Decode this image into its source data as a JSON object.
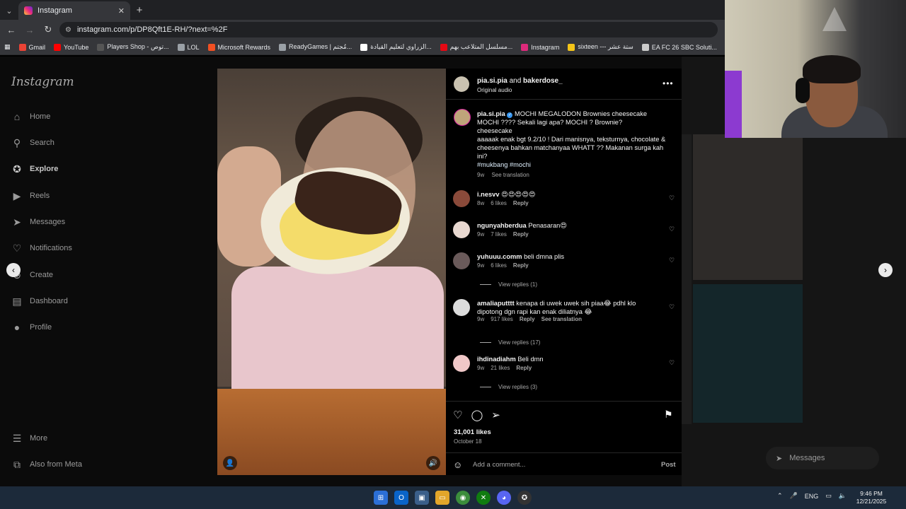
{
  "browser": {
    "tab_title": "Instagram",
    "new_tab": "+",
    "url": "instagram.com/p/DP8Qft1E-RH/?next=%2F",
    "bookmarks": [
      {
        "label": "Gmail",
        "color": "#ea4335"
      },
      {
        "label": "YouTube",
        "color": "#ff0000"
      },
      {
        "label": "Players Shop - توص...",
        "color": "#555555"
      },
      {
        "label": "LOL",
        "color": "#9aa0a6"
      },
      {
        "label": "Microsoft Rewards",
        "color": "#f25022"
      },
      {
        "label": "ReadyGames | مُجتم...",
        "color": "#9aa0a6"
      },
      {
        "label": "الزراوي لتعليم القيادة...",
        "color": "#ffffff"
      },
      {
        "label": "مسلسل المتلاعب بهم...",
        "color": "#e50914"
      },
      {
        "label": "Instagram",
        "color": "#dd2a7b"
      },
      {
        "label": "sixteen --- ستة عشر",
        "color": "#f5c518"
      },
      {
        "label": "EA FC 26 SBC Soluti...",
        "color": "#cccccc"
      }
    ]
  },
  "sidebar": {
    "logo": "Instagram",
    "items": [
      {
        "label": "Home",
        "icon": "home-icon",
        "glyph": "⌂"
      },
      {
        "label": "Search",
        "icon": "search-icon",
        "glyph": "⚲"
      },
      {
        "label": "Explore",
        "icon": "compass-icon",
        "glyph": "✪"
      },
      {
        "label": "Reels",
        "icon": "reels-icon",
        "glyph": "▶"
      },
      {
        "label": "Messages",
        "icon": "send-icon",
        "glyph": "➤"
      },
      {
        "label": "Notifications",
        "icon": "heart-icon",
        "glyph": "♡"
      },
      {
        "label": "Create",
        "icon": "plus-icon",
        "glyph": "⊕"
      },
      {
        "label": "Dashboard",
        "icon": "chart-icon",
        "glyph": "▤"
      },
      {
        "label": "Profile",
        "icon": "avatar-icon",
        "glyph": "●"
      }
    ],
    "more": "More",
    "also_from_meta": "Also from Meta"
  },
  "post": {
    "author": "pia.si.pia",
    "and": "and",
    "coauthor": "bakerdose_",
    "audio": "Original audio",
    "caption_user": "pia.si.pia",
    "caption_text": "MOCHI MEGALODON Brownies cheesecake MOCHI ???? Sekali lagi apa? MOCHI ? Brownie?",
    "caption_line2": "cheesecake",
    "caption_line3": "aaaaak enak bgt 9.2/10 ! Dari manisnya, teksturnya, chocolate & cheesenya bahkan matchanyaa WHATT ?? Makanan surga kah ini?",
    "hashtags": "#mukbang #mochi",
    "age": "9w",
    "see_translation": "See translation",
    "likes": "31,001 likes",
    "date": "October 18",
    "add_comment_placeholder": "Add a comment...",
    "post_button": "Post"
  },
  "comments": [
    {
      "user": "i.nesvv",
      "text": "😍😍😍😍😍",
      "age": "8w",
      "likes": "6 likes",
      "reply": "Reply",
      "avatar_color": "#8a4a3a"
    },
    {
      "user": "ngunyahberdua",
      "text": "Penasaran😍",
      "age": "9w",
      "likes": "7 likes",
      "reply": "Reply",
      "avatar_color": "#e8d8d0"
    },
    {
      "user": "yuhuuu.comm",
      "text": "beli dmna plis",
      "age": "9w",
      "likes": "6 likes",
      "reply": "Reply",
      "avatar_color": "#6a5a5a",
      "view_replies": "View replies (1)"
    },
    {
      "user": "amaliaputttt",
      "text": "kenapa di uwek uwek sih piaa😂 pdhl klo dipotong dgn rapi kan enak diliatnya 😂",
      "age": "9w",
      "likes": "917 likes",
      "reply": "Reply",
      "translation": "See translation",
      "avatar_color": "#dcdcdc",
      "view_replies": "View replies (17)"
    },
    {
      "user": "ihdinadiahm",
      "text": "Beli dmn",
      "age": "9w",
      "likes": "21 likes",
      "reply": "Reply",
      "avatar_color": "#f0c8c8",
      "view_replies": "View replies (3)"
    }
  ],
  "messages_pill": "Messages",
  "taskbar": {
    "lang": "ENG",
    "time": "9:46 PM",
    "date": "12/21/2025"
  },
  "colors": {
    "accent": "#3897f0",
    "bg": "#000000"
  }
}
